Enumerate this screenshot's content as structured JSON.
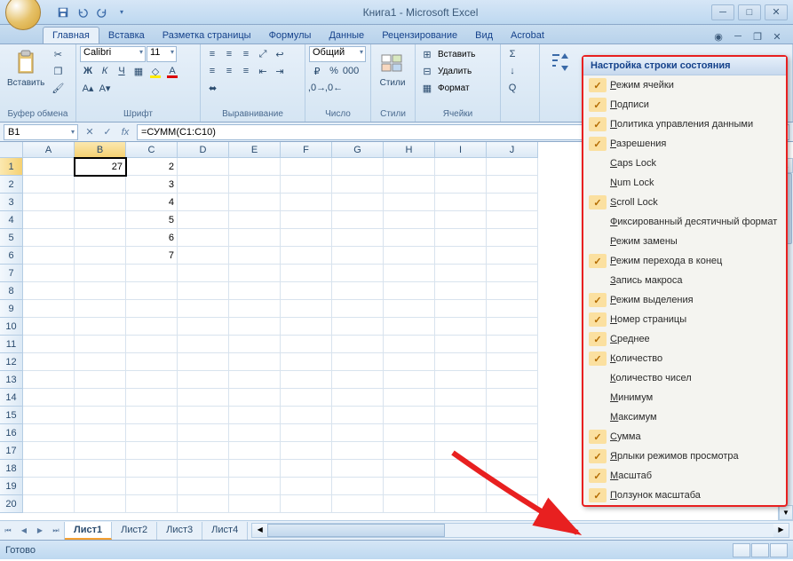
{
  "title": "Книга1 - Microsoft Excel",
  "tabs": [
    "Главная",
    "Вставка",
    "Разметка страницы",
    "Формулы",
    "Данные",
    "Рецензирование",
    "Вид",
    "Acrobat"
  ],
  "ribbon": {
    "clipboard": {
      "paste": "Вставить",
      "label": "Буфер обмена"
    },
    "font": {
      "name": "Calibri",
      "size": "11",
      "label": "Шрифт"
    },
    "align": {
      "label": "Выравнивание"
    },
    "number": {
      "fmt": "Общий",
      "label": "Число"
    },
    "styles": {
      "label": "Стили",
      "btn": "Стили"
    },
    "cells": {
      "insert": "Вставить",
      "delete": "Удалить",
      "format": "Формат",
      "label": "Ячейки"
    }
  },
  "namebox": "B1",
  "formula": "=СУММ(C1:C10)",
  "columns": [
    "A",
    "B",
    "C",
    "D",
    "E",
    "F",
    "G",
    "H",
    "I",
    "J"
  ],
  "rows": 20,
  "activeCell": {
    "r": 0,
    "c": 1
  },
  "cellData": {
    "r0c1": "27",
    "r0c2": "2",
    "r1c2": "3",
    "r2c2": "4",
    "r3c2": "5",
    "r4c2": "6",
    "r5c2": "7"
  },
  "sheets": [
    "Лист1",
    "Лист2",
    "Лист3",
    "Лист4"
  ],
  "status": "Готово",
  "ctx": {
    "title": "Настройка строки состояния",
    "items": [
      {
        "on": true,
        "label": "Режим ячейки"
      },
      {
        "on": true,
        "label": "Подписи"
      },
      {
        "on": true,
        "label": "Политика управления данными"
      },
      {
        "on": true,
        "label": "Разрешения"
      },
      {
        "on": false,
        "label": "Caps Lock"
      },
      {
        "on": false,
        "label": "Num Lock"
      },
      {
        "on": true,
        "label": "Scroll Lock"
      },
      {
        "on": false,
        "label": "Фиксированный десятичный формат"
      },
      {
        "on": false,
        "label": "Режим замены"
      },
      {
        "on": true,
        "label": "Режим перехода  в конец"
      },
      {
        "on": false,
        "label": "Запись макроса"
      },
      {
        "on": true,
        "label": "Режим выделения"
      },
      {
        "on": true,
        "label": "Номер страницы"
      },
      {
        "on": true,
        "label": "Среднее"
      },
      {
        "on": true,
        "label": "Количество"
      },
      {
        "on": false,
        "label": "Количество чисел"
      },
      {
        "on": false,
        "label": "Минимум"
      },
      {
        "on": false,
        "label": "Максимум"
      },
      {
        "on": true,
        "label": "Сумма"
      },
      {
        "on": true,
        "label": "Ярлыки режимов просмотра"
      },
      {
        "on": true,
        "label": "Масштаб"
      },
      {
        "on": true,
        "label": "Ползунок масштаба"
      }
    ]
  }
}
